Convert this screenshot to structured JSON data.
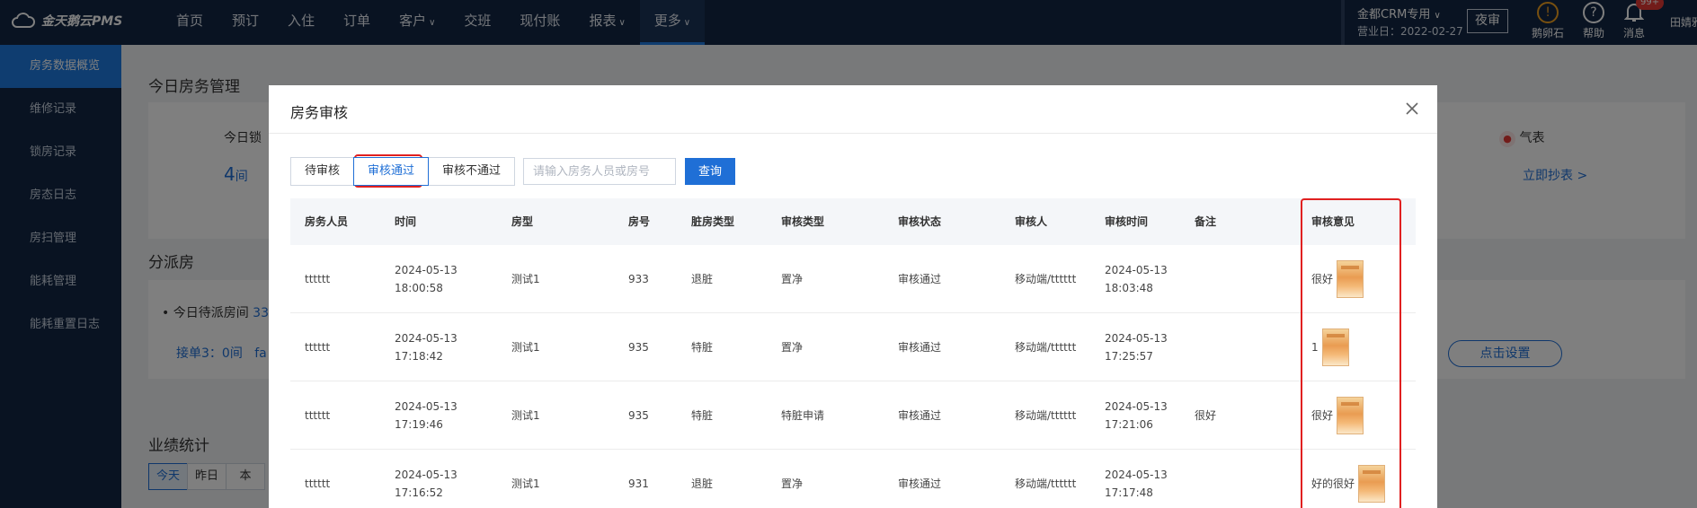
{
  "app": {
    "logo_text": "金天鹅云PMS"
  },
  "nav": {
    "items": [
      {
        "label": "首页",
        "chevron": false,
        "active": false
      },
      {
        "label": "预订",
        "chevron": false,
        "active": false
      },
      {
        "label": "入住",
        "chevron": false,
        "active": false
      },
      {
        "label": "订单",
        "chevron": false,
        "active": false
      },
      {
        "label": "客户",
        "chevron": true,
        "active": false
      },
      {
        "label": "交班",
        "chevron": false,
        "active": false
      },
      {
        "label": "现付账",
        "chevron": false,
        "active": false
      },
      {
        "label": "报表",
        "chevron": true,
        "active": false
      },
      {
        "label": "更多",
        "chevron": true,
        "active": true
      }
    ]
  },
  "topright": {
    "hotel": "金都CRM专用",
    "business_day": "营业日：2022-02-27",
    "night_audit": "夜审",
    "tools": [
      {
        "label": "鹅卵石",
        "icon": "warning-icon"
      },
      {
        "label": "帮助",
        "icon": "help-icon"
      },
      {
        "label": "消息",
        "icon": "bell-icon",
        "badge": "99+"
      }
    ],
    "user": "田婧雅"
  },
  "sidebar": {
    "items": [
      {
        "label": "房务数据概览",
        "active": true
      },
      {
        "label": "维修记录",
        "active": false
      },
      {
        "label": "锁房记录",
        "active": false
      },
      {
        "label": "房态日志",
        "active": false
      },
      {
        "label": "房扫管理",
        "active": false
      },
      {
        "label": "能耗管理",
        "active": false
      },
      {
        "label": "能耗重置日志",
        "active": false
      }
    ]
  },
  "background": {
    "today_title": "今日房务管理",
    "today_lock": "今日锁",
    "count_num": "4",
    "count_unit": "间",
    "gas_label": "气表",
    "meter_link": "立即抄表 >",
    "assign_title": "分派房",
    "pending": "今日待派房间",
    "pending_num": "33",
    "receive": "接单3：0间",
    "receive_more": "fa",
    "set_button": "点击设置",
    "perf_title": "业绩统计",
    "period_tabs": [
      "今天",
      "昨日",
      "本"
    ]
  },
  "modal": {
    "title": "房务审核",
    "filter_tabs": [
      {
        "label": "待审核",
        "active": false
      },
      {
        "label": "审核通过",
        "active": true
      },
      {
        "label": "审核不通过",
        "active": false
      }
    ],
    "search": {
      "placeholder": "请输入房务人员或房号",
      "value": ""
    },
    "query_label": "查询",
    "columns": [
      "房务人员",
      "时间",
      "房型",
      "房号",
      "脏房类型",
      "审核类型",
      "审核状态",
      "审核人",
      "审核时间",
      "备注",
      "审核意见"
    ],
    "rows": [
      {
        "staff": "tttttt",
        "time_date": "2024-05-13",
        "time_clock": "18:00:58",
        "room_type": "测试1",
        "room_no": "933",
        "dirty_type": "退脏",
        "audit_type": "置净",
        "status": "审核通过",
        "auditor": "移动端/tttttt",
        "audit_date": "2024-05-13",
        "audit_clock": "18:03:48",
        "remark": "",
        "opinion": "很好"
      },
      {
        "staff": "tttttt",
        "time_date": "2024-05-13",
        "time_clock": "17:18:42",
        "room_type": "测试1",
        "room_no": "935",
        "dirty_type": "特脏",
        "audit_type": "置净",
        "status": "审核通过",
        "auditor": "移动端/tttttt",
        "audit_date": "2024-05-13",
        "audit_clock": "17:25:57",
        "remark": "",
        "opinion": "1"
      },
      {
        "staff": "tttttt",
        "time_date": "2024-05-13",
        "time_clock": "17:19:46",
        "room_type": "测试1",
        "room_no": "935",
        "dirty_type": "特脏",
        "audit_type": "特脏申请",
        "status": "审核通过",
        "auditor": "移动端/tttttt",
        "audit_date": "2024-05-13",
        "audit_clock": "17:21:06",
        "remark": "很好",
        "opinion": "很好"
      },
      {
        "staff": "tttttt",
        "time_date": "2024-05-13",
        "time_clock": "17:16:52",
        "room_type": "测试1",
        "room_no": "931",
        "dirty_type": "退脏",
        "audit_type": "置净",
        "status": "审核通过",
        "auditor": "移动端/tttttt",
        "audit_date": "2024-05-13",
        "audit_clock": "17:17:48",
        "remark": "",
        "opinion": "好的很好"
      }
    ]
  },
  "colors": {
    "accent": "#1f6fd6",
    "nav_bg": "#132744",
    "highlight_box": "#e02020"
  }
}
